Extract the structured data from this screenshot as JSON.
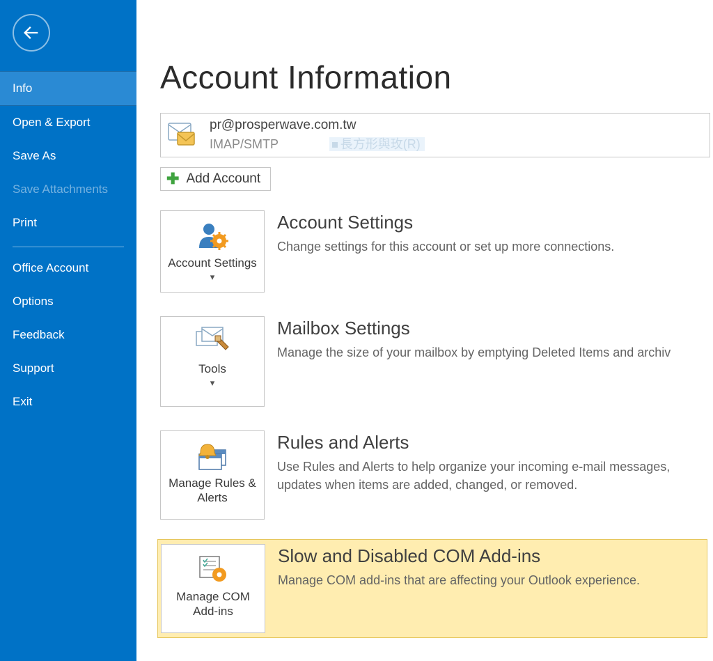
{
  "sidebar": {
    "items": [
      {
        "label": "Info",
        "selected": true,
        "disabled": false
      },
      {
        "label": "Open & Export",
        "selected": false,
        "disabled": false
      },
      {
        "label": "Save As",
        "selected": false,
        "disabled": false
      },
      {
        "label": "Save Attachments",
        "selected": false,
        "disabled": true
      },
      {
        "label": "Print",
        "selected": false,
        "disabled": false
      }
    ],
    "lower_items": [
      {
        "label": "Office Account"
      },
      {
        "label": "Options"
      },
      {
        "label": "Feedback"
      },
      {
        "label": "Support"
      },
      {
        "label": "Exit"
      }
    ]
  },
  "page": {
    "title": "Account Information",
    "account_email": "pr@prosperwave.com.tw",
    "account_type": "IMAP/SMTP",
    "account_ghost": "長方形與玫(R)",
    "add_account_label": "Add Account"
  },
  "sections": {
    "account_settings": {
      "card_label": "Account Settings",
      "title": "Account Settings",
      "desc": "Change settings for this account or set up more connections."
    },
    "mailbox": {
      "card_label": "Tools",
      "title": "Mailbox Settings",
      "desc": "Manage the size of your mailbox by emptying Deleted Items and archiv"
    },
    "rules": {
      "card_label": "Manage Rules & Alerts",
      "title": "Rules and Alerts",
      "desc": "Use Rules and Alerts to help organize your incoming e-mail messages, updates when items are added, changed, or removed."
    },
    "com": {
      "card_label": "Manage COM Add-ins",
      "title": "Slow and Disabled COM Add-ins",
      "desc": "Manage COM add-ins that are affecting your Outlook experience."
    }
  }
}
